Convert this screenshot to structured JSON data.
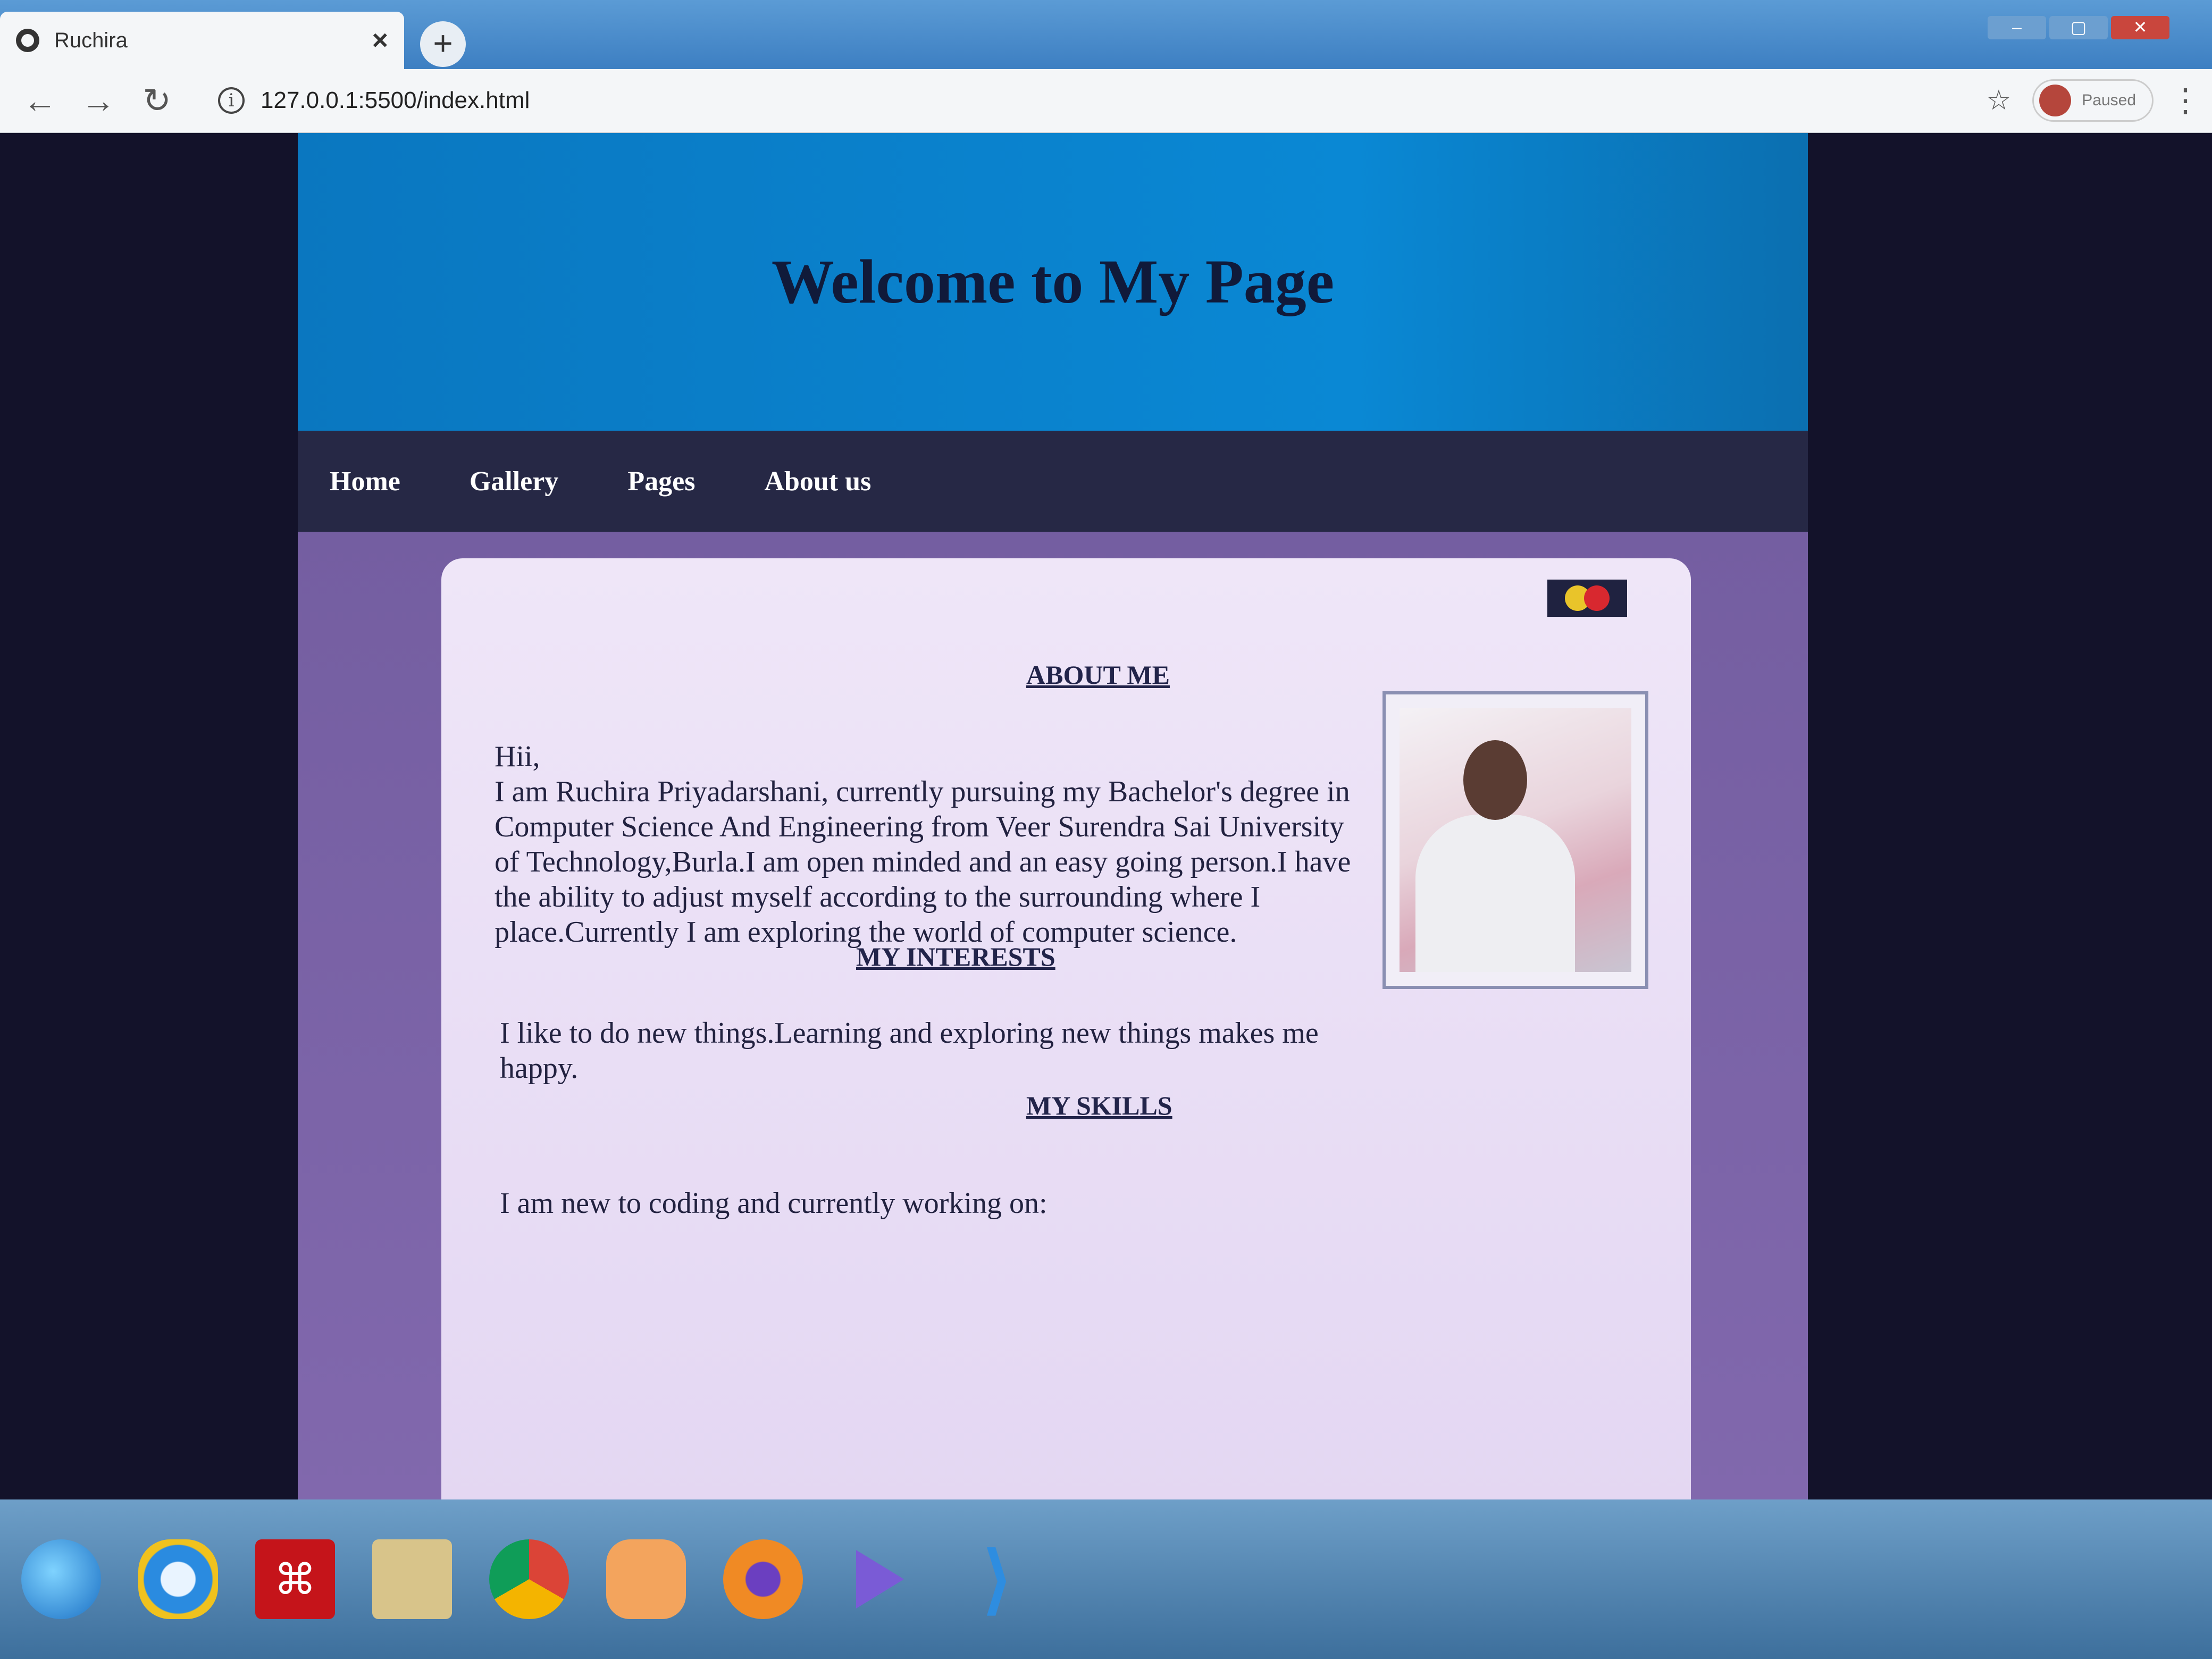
{
  "browser": {
    "tab_title": "Ruchira",
    "tab_close": "×",
    "new_tab": "+",
    "url": "127.0.0.1:5500/index.html",
    "profile_status": "Paused"
  },
  "site": {
    "title": "Welcome to My Page",
    "nav": [
      "Home",
      "Gallery",
      "Pages",
      "About us"
    ]
  },
  "content": {
    "about_heading": "ABOUT ME",
    "greeting": "Hii,",
    "about_text": "I am Ruchira Priyadarshani, currently pursuing my Bachelor's degree in Computer Science And Engineering from Veer Surendra Sai University of Technology,Burla.I am open minded and an easy going person.I have the ability to adjust myself according to the surrounding where I place.Currently I am exploring the world of computer science.",
    "interests_heading": "MY INTERESTS",
    "interests_text": "I like to do new things.Learning and exploring new things makes me happy.",
    "skills_heading": "MY SKILLS",
    "skills_text": "I am new to coding and currently working on:"
  },
  "colors": {
    "header_bg": "#0a88d4",
    "nav_bg": "#262845",
    "page_bg": "#7460a2",
    "card_bg": "#ebe0f6"
  },
  "icons": {
    "theme_toggle": "moon-icon",
    "taskbar": [
      "windows-start-icon",
      "internet-explorer-icon",
      "acrobat-icon",
      "folder-icon",
      "chrome-icon",
      "media-player-icon",
      "firefox-icon",
      "play-icon",
      "vscode-icon"
    ]
  }
}
